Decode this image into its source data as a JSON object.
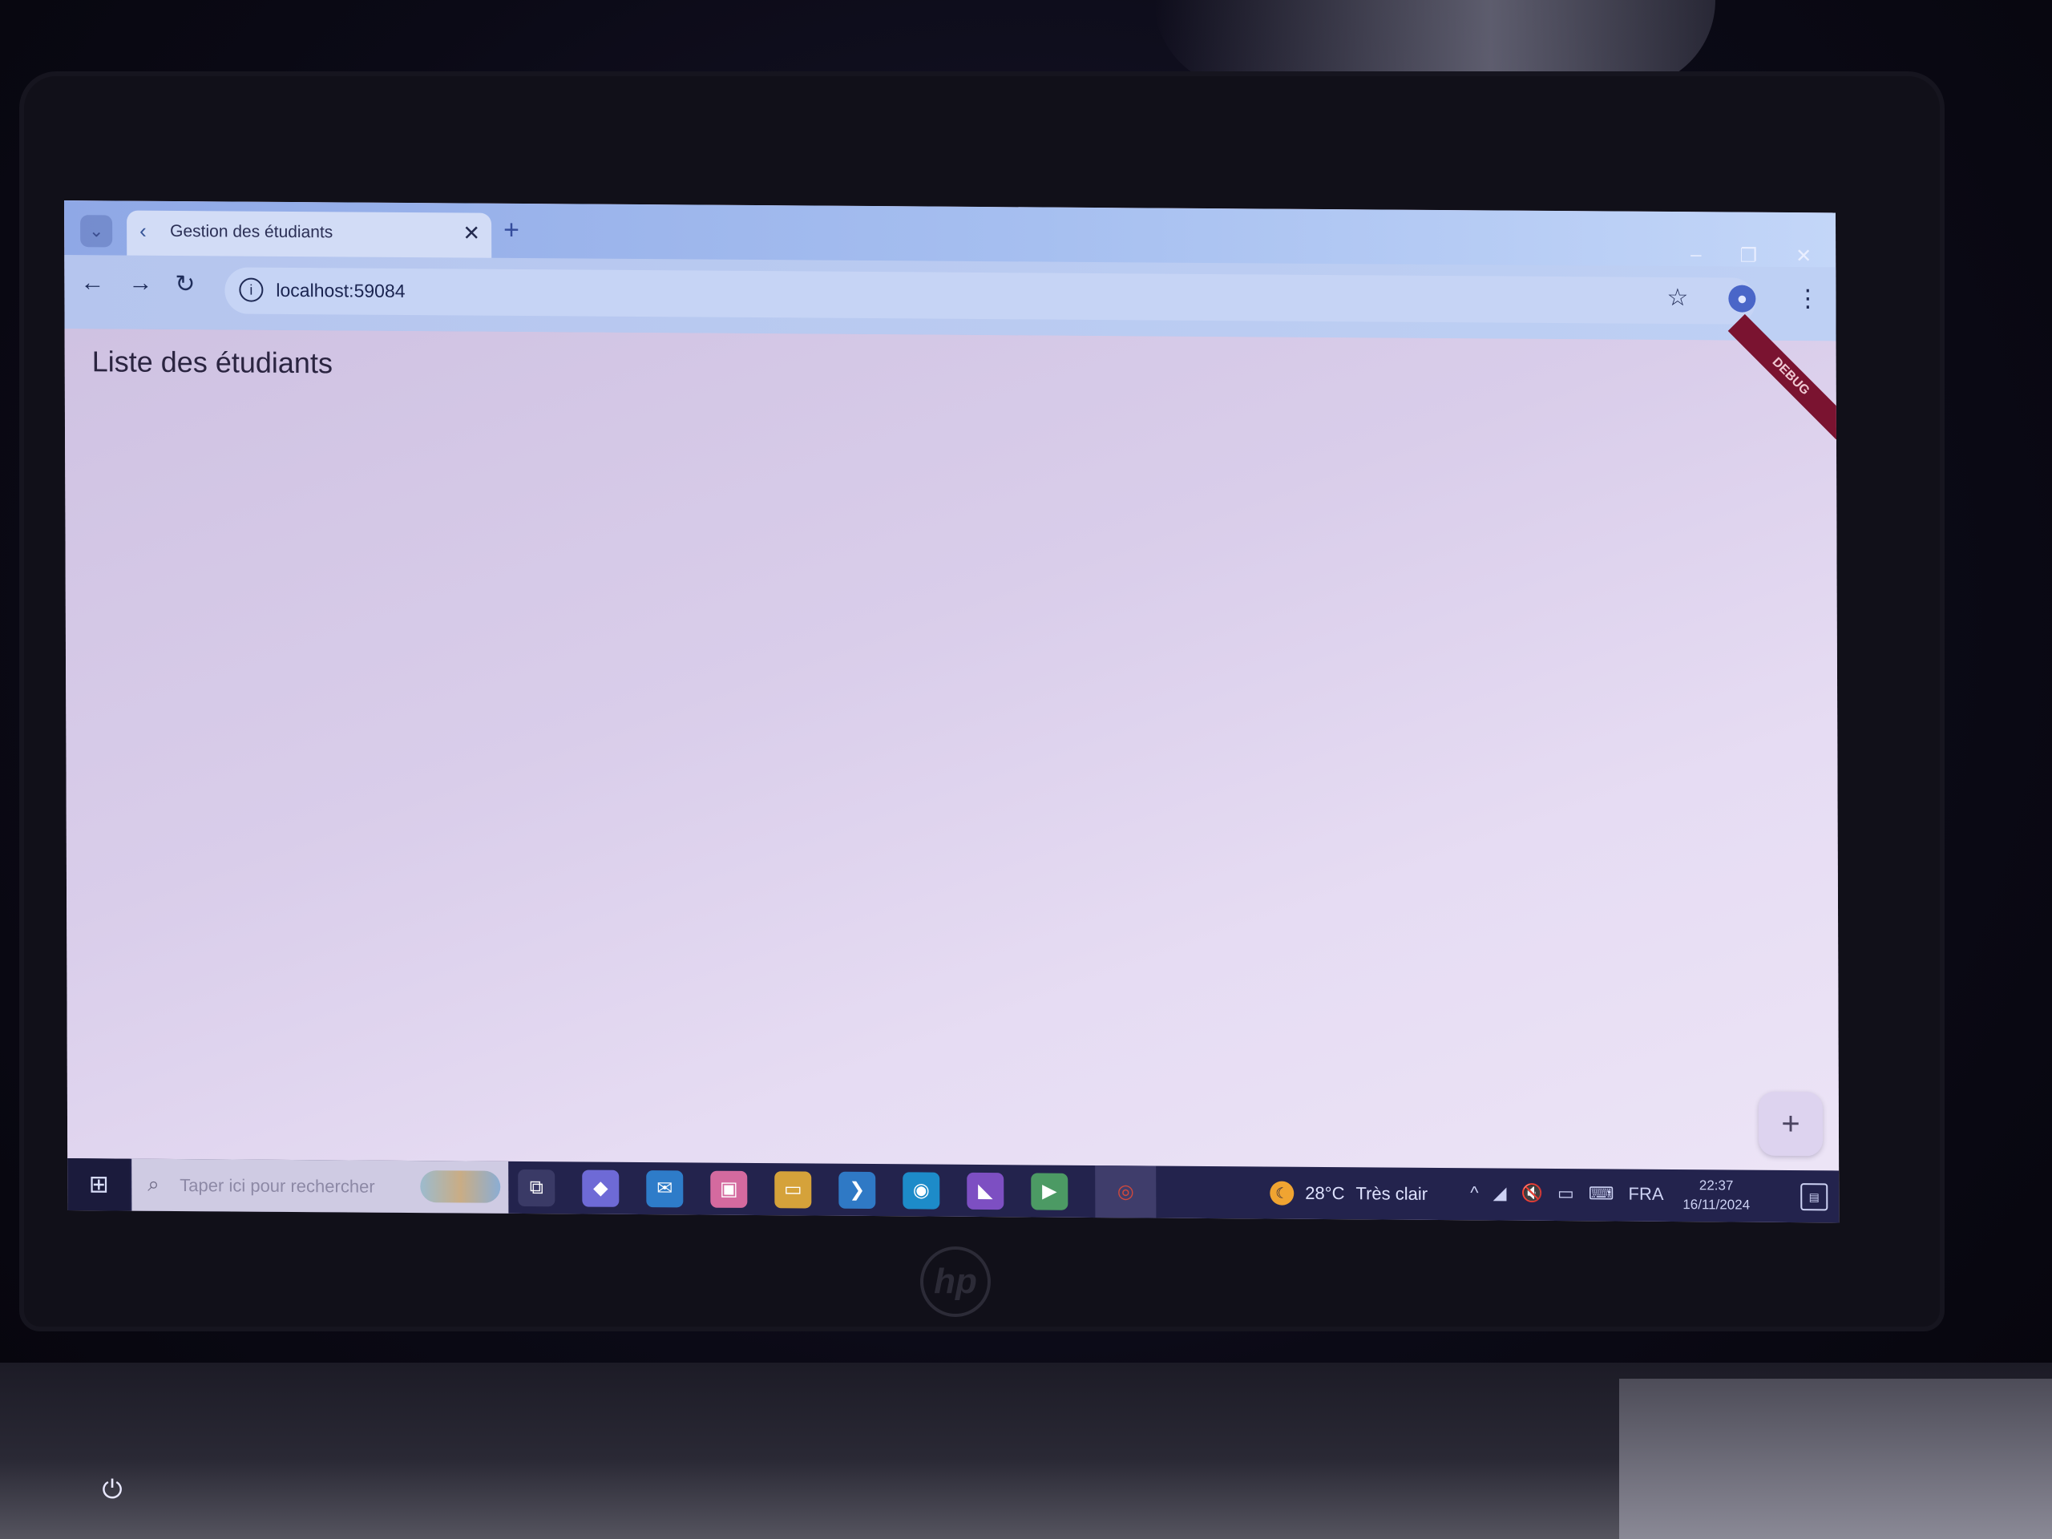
{
  "browser": {
    "tab": {
      "title": "Gestion des étudiants",
      "back_icon": "chevron-left-icon",
      "close_icon": "close-icon",
      "close_glyph": "✕"
    },
    "new_tab_glyph": "+",
    "tab_menu_glyph": "⌄",
    "window_controls": [
      "–",
      "❐",
      "✕"
    ],
    "nav": {
      "back_glyph": "←",
      "forward_glyph": "→",
      "reload_glyph": "↻"
    },
    "address": {
      "url": "localhost:59084",
      "info_glyph": "i"
    },
    "toolbar": {
      "star_glyph": "☆",
      "profile_glyph": "●",
      "menu_glyph": "⋮"
    }
  },
  "page": {
    "title": "Liste des étudiants",
    "debug_banner": "DEBUG",
    "fab_glyph": "+"
  },
  "taskbar": {
    "start_glyph": "⊞",
    "search_placeholder": "Taper ici pour rechercher",
    "search_glyph": "⌕",
    "apps": [
      {
        "name": "task-view-icon",
        "glyph": "⧉",
        "color": "#3a3a66"
      },
      {
        "name": "copilot-icon",
        "glyph": "◆",
        "color": "#6e6ad6"
      },
      {
        "name": "mail-icon",
        "glyph": "✉",
        "color": "#2e7cc9"
      },
      {
        "name": "store-icon",
        "glyph": "▣",
        "color": "#d46a9f"
      },
      {
        "name": "file-explorer-icon",
        "glyph": "▭",
        "color": "#d5a23a"
      },
      {
        "name": "vscode-icon",
        "glyph": "❯",
        "color": "#2f79c5"
      },
      {
        "name": "edge-icon",
        "glyph": "◉",
        "color": "#1d8bc9"
      },
      {
        "name": "visual-studio-icon",
        "glyph": "◣",
        "color": "#7d4fc2"
      },
      {
        "name": "android-studio-icon",
        "glyph": "▶",
        "color": "#4c9a64"
      },
      {
        "name": "chrome-icon",
        "glyph": "◎",
        "color": "#d1493c"
      }
    ],
    "weather": {
      "temp": "28°C",
      "condition": "Très clair",
      "icon": "weather-moon-icon"
    },
    "tray": {
      "chevron_glyph": "^",
      "wifi_glyph": "◢",
      "volume_glyph": "🔇",
      "battery_glyph": "▭",
      "keyboard_glyph": "⌨",
      "language": "FRA"
    },
    "clock": {
      "time": "22:37",
      "date": "16/11/2024"
    },
    "notification_glyph": "▤"
  },
  "device": {
    "brand_logo": "hp",
    "power_glyph": "⏻"
  }
}
